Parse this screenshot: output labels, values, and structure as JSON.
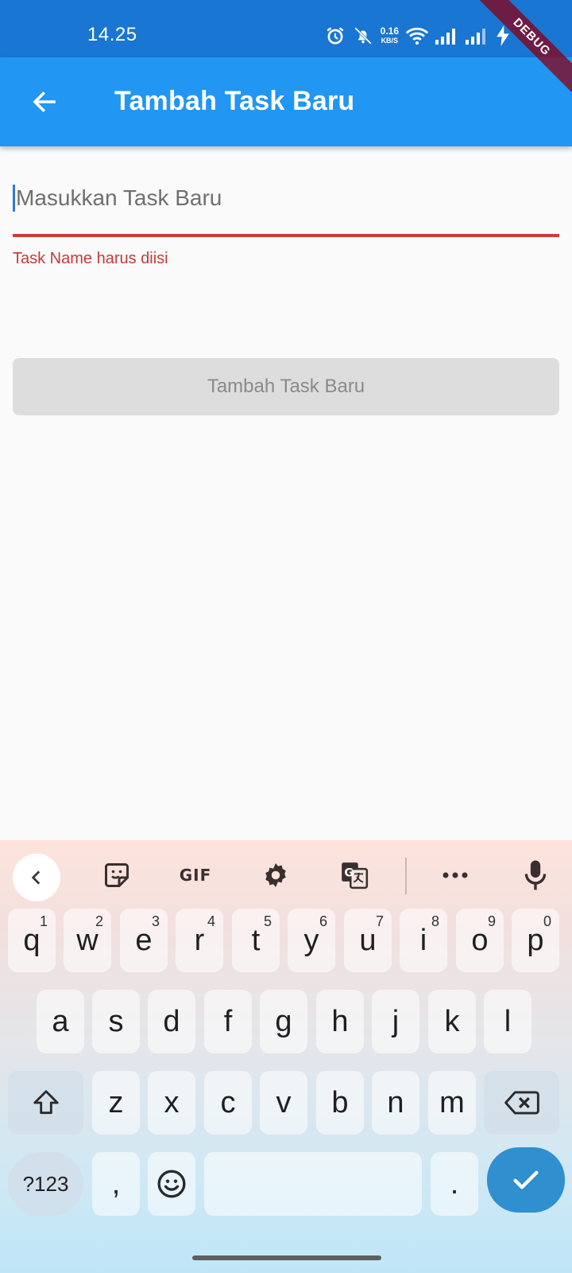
{
  "status_bar": {
    "time": "14.25",
    "net_speed_value": "0.16",
    "net_speed_unit": "KB/S",
    "debug_label": "DEBUG",
    "icons": [
      "alarm-icon",
      "mute-icon",
      "wifi-icon",
      "signal-icon",
      "signal-icon",
      "charging-icon"
    ]
  },
  "app_bar": {
    "title": "Tambah Task Baru",
    "back_icon": "arrow-left-icon",
    "color": "#2196f3"
  },
  "form": {
    "task_name": {
      "value": "",
      "placeholder": "Masukkan Task Baru",
      "error": "Task Name harus diisi",
      "error_color": "#c63a3a"
    },
    "submit_label": "Tambah Task Baru"
  },
  "keyboard": {
    "toolbar": [
      "chevron-left-icon",
      "sticker-icon",
      "gif-icon",
      "settings-icon",
      "translate-icon",
      "more-icon",
      "mic-icon"
    ],
    "gif_label": "GIF",
    "row1": [
      {
        "k": "q",
        "n": "1"
      },
      {
        "k": "w",
        "n": "2"
      },
      {
        "k": "e",
        "n": "3"
      },
      {
        "k": "r",
        "n": "4"
      },
      {
        "k": "t",
        "n": "5"
      },
      {
        "k": "y",
        "n": "6"
      },
      {
        "k": "u",
        "n": "7"
      },
      {
        "k": "i",
        "n": "8"
      },
      {
        "k": "o",
        "n": "9"
      },
      {
        "k": "p",
        "n": "0"
      }
    ],
    "row2": [
      "a",
      "s",
      "d",
      "f",
      "g",
      "h",
      "j",
      "k",
      "l"
    ],
    "row3": [
      "z",
      "x",
      "c",
      "v",
      "b",
      "n",
      "m"
    ],
    "symbols_label": "?123",
    "comma": ",",
    "period": "."
  }
}
